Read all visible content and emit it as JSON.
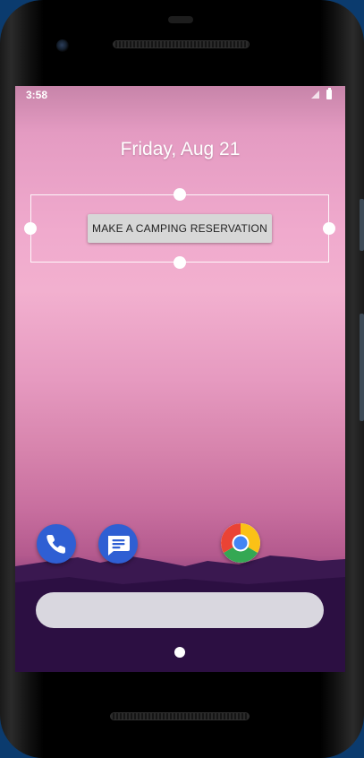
{
  "status_bar": {
    "time": "3:58",
    "icons": [
      "signal-icon",
      "battery-icon"
    ]
  },
  "home_screen": {
    "date": "Friday, Aug 21",
    "widget": {
      "button_label": "MAKE A CAMPING RESERVATION"
    },
    "dock": {
      "apps": [
        "phone-app-icon",
        "messages-app-icon",
        "chrome-app-icon"
      ]
    }
  },
  "colors": {
    "wallpaper_top": "#f0aacd",
    "wallpaper_bottom": "#220b36",
    "dock_icon_blue": "#2f5fd3",
    "button_bg": "#d7d7d7",
    "search_bar": "#d9d7df"
  }
}
